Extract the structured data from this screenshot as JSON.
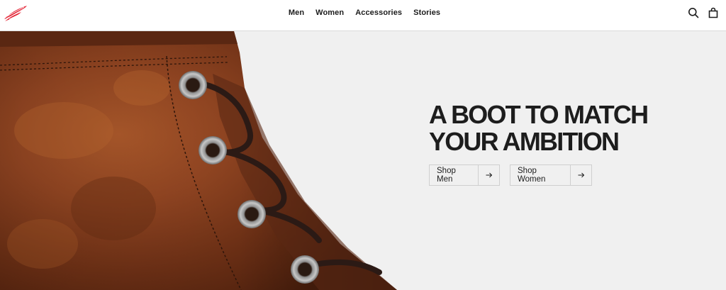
{
  "brand": {
    "logo_icon": "red-wing-logo-icon",
    "accent_color": "#e31e30"
  },
  "header": {
    "nav": [
      {
        "label": "Men"
      },
      {
        "label": "Women"
      },
      {
        "label": "Accessories"
      },
      {
        "label": "Stories"
      }
    ],
    "icons": [
      "search-icon",
      "cart-icon"
    ]
  },
  "hero": {
    "image": "leather-boot-closeup-image",
    "headline_line1": "A BOOT TO MATCH",
    "headline_line2": "YOUR AMBITION",
    "buttons": [
      {
        "label": "Shop Men",
        "icon": "arrow-right-icon"
      },
      {
        "label": "Shop Women",
        "icon": "arrow-right-icon"
      }
    ],
    "background_color": "#f0f0f0"
  }
}
